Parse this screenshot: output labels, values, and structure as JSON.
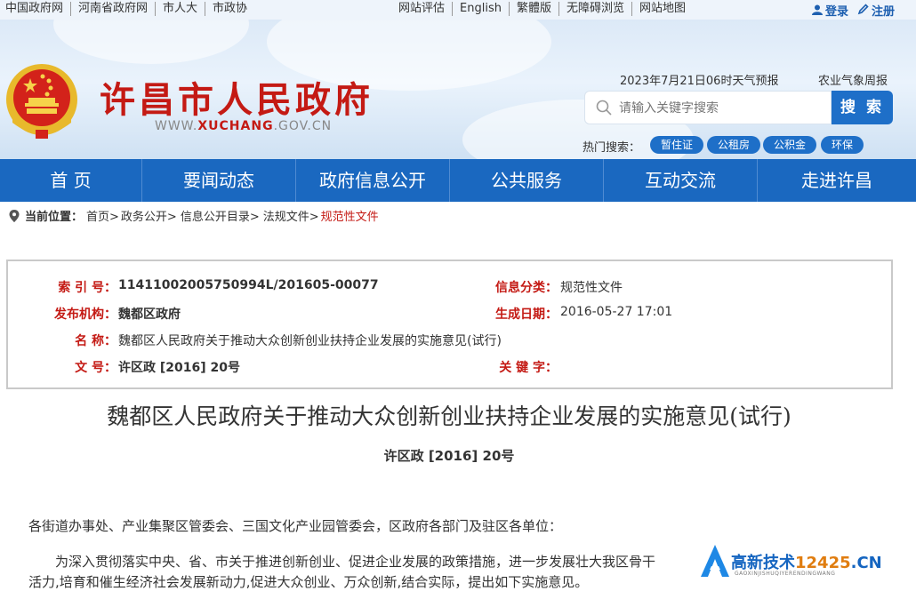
{
  "topbar": {
    "left_links": [
      "中国政府网",
      "河南省政府网",
      "市人大",
      "市政协"
    ],
    "mid_links": [
      "网站评估",
      "English",
      "繁體版",
      "无障碍浏览",
      "网站地图"
    ],
    "login": "登录",
    "register": "注册"
  },
  "header": {
    "title": "许昌市人民政府",
    "url_prefix": "WWW.",
    "url_brand": "XUCHANG",
    "url_suffix": ".GOV.CN",
    "weather": "2023年7月21日06时天气预报",
    "agri_weather": "农业气象周报",
    "search_placeholder": "请输入关键字搜索",
    "search_button": "搜 索",
    "hot_label": "热门搜索：",
    "hot_tags": [
      "暂住证",
      "公租房",
      "公积金",
      "环保"
    ]
  },
  "nav": [
    "首 页",
    "要闻动态",
    "政府信息公开",
    "公共服务",
    "互动交流",
    "走进许昌"
  ],
  "breadcrumb": {
    "label": "当前位置：",
    "items": [
      "首页>",
      "政务公开>",
      "信息公开目录>",
      "法规文件>"
    ],
    "current": "规范性文件"
  },
  "meta": {
    "index_label": "索 引 号：",
    "index_value": "11411002005750994L/201605-00077",
    "category_label": "信息分类：",
    "category_value": "规范性文件",
    "publisher_label": "发布机构：",
    "publisher_value": "魏都区政府",
    "date_label": "生成日期：",
    "date_value": "2016-05-27 17:01",
    "name_label": "名 称：",
    "name_value": "魏都区人民政府关于推动大众创新创业扶持企业发展的实施意见(试行)",
    "docno_label": "文 号：",
    "docno_value": "许区政 [2016] 20号",
    "keywords_label": "关 键 字："
  },
  "document": {
    "title": "魏都区人民政府关于推动大众创新创业扶持企业发展的实施意见(试行)",
    "number": "许区政 [2016] 20号",
    "addressee": "各街道办事处、产业集聚区管委会、三国文化产业园管委会，区政府各部门及驻区各单位：",
    "para1_line1": "为深入贯彻落实中央、省、市关于推进创新创业、促进企业发展的政策措施，进一步发展壮大我区骨干",
    "para1_line2": "活力,培育和催生经济社会发展新动力,促进大众创业、万众创新,结合实际，提出如下实施意见。"
  },
  "watermark": {
    "text_prefix": "高新技术",
    "text_num": "12425",
    "text_suffix": ".CN",
    "sub": "GAOXINJISHUQIYERENDINGWANG"
  },
  "colors": {
    "brand_red": "#c41a14",
    "nav_blue": "#1a68c0",
    "accent_blue": "#1e6fc8"
  }
}
